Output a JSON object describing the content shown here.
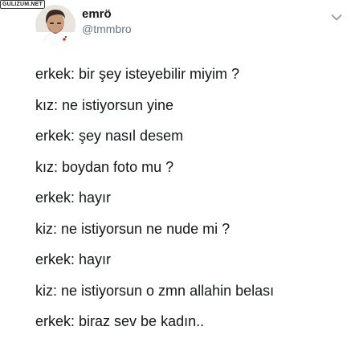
{
  "watermark": "GULIZUM.NET",
  "user": {
    "display_name": "emrö",
    "handle": "@tmmbro",
    "avatar_icon": "avatar-photo"
  },
  "menu": {
    "icon": "chevron-down-icon"
  },
  "tweet": {
    "lines": [
      "erkek: bir şey isteyebilir miyim ?",
      "kız: ne istiyorsun yine",
      "erkek: şey nasıl desem",
      "kız: boydan foto mu ?",
      "erkek: hayır",
      "kiz: ne istiyorsun ne nude mi ?",
      "erkek: hayır",
      "kiz: ne istiyorsun o zmn allahin belası",
      "erkek: biraz sev be kadın.."
    ]
  },
  "colors": {
    "text": "#14171a",
    "secondary": "#657786",
    "background": "#ffffff"
  }
}
